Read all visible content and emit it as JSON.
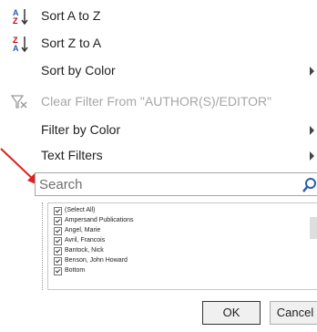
{
  "menu": {
    "sort_az": "Sort A to Z",
    "sort_za": "Sort Z to A",
    "sort_color": "Sort by Color",
    "clear_filter": "Clear Filter From \"AUTHOR(S)/EDITOR\"",
    "filter_color": "Filter by Color",
    "text_filters": "Text Filters"
  },
  "search": {
    "placeholder": "Search",
    "value": ""
  },
  "list": {
    "items": [
      "(Select All)",
      "Ampersand Publications",
      "Angel, Marie",
      "Avril, Francois",
      "Bantock, Nick",
      "Benson, John Howard",
      "Bottom"
    ]
  },
  "buttons": {
    "ok": "OK",
    "cancel": "Cancel"
  },
  "icons": {
    "sort_az": "sort-ascending-icon",
    "sort_za": "sort-descending-icon",
    "clear_filter": "clear-filter-icon",
    "search": "search-icon",
    "annotation": "red-arrow-icon"
  },
  "colors": {
    "annotation_arrow": "#e02020",
    "sort_icon_blue": "#2a5db0",
    "sort_icon_red": "#c00000"
  }
}
